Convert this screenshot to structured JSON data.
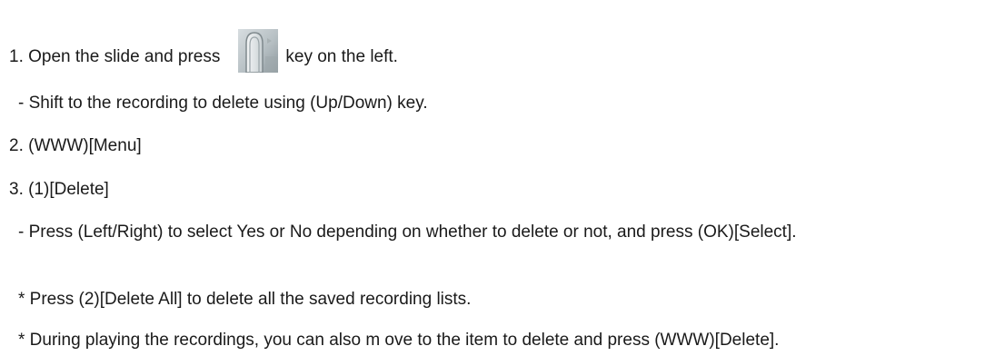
{
  "instructions": {
    "step1_prefix": "1. Open the slide and press",
    "step1_suffix": "key on the left.",
    "step1_key_icon": "side-record-key-icon",
    "step1_note": "- Shift to the recording to delete using (Up/Down) key.",
    "step2": "2. (WWW)[Menu]",
    "step3": "3. (1)[Delete]",
    "step3_note": "- Press (Left/Right) to select Yes or No depending on whether to delete or not, and press (OK)[Select].",
    "tip1": "* Press (2)[Delete All] to delete all the saved recording lists.",
    "tip2": "* During playing the recordings, you can also m ove to the item to delete and press (WWW)[Delete]."
  }
}
